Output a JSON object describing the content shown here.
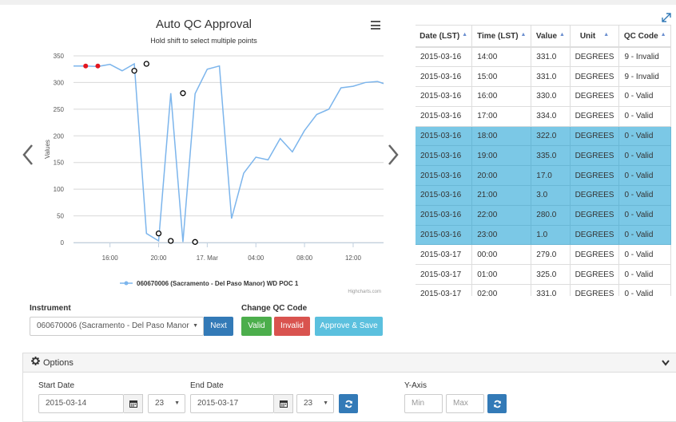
{
  "chart": {
    "title": "Auto QC Approval",
    "subtitle": "Hold shift to select multiple points",
    "ylabel": "Values",
    "legend": "060670006 (Sacramento - Del Paso Manor) WD POC 1",
    "credit": "Highcharts.com"
  },
  "chart_data": {
    "type": "line",
    "title": "Auto QC Approval",
    "ylabel": "Values",
    "ylim": [
      0,
      350
    ],
    "yticks": [
      0,
      50,
      100,
      150,
      200,
      250,
      300,
      350
    ],
    "x_tick_labels": [
      "16:00",
      "20:00",
      "17. Mar",
      "04:00",
      "08:00",
      "12:00"
    ],
    "x_tick_hours": [
      16,
      20,
      24,
      28,
      32,
      36
    ],
    "x_unit": "hours from 2015-03-16 00:00",
    "xlim": [
      13,
      38.5
    ],
    "series": [
      {
        "name": "060670006 (Sacramento - Del Paso Manor) WD POC 1",
        "color": "#7cb5ec",
        "x": [
          13,
          14,
          15,
          16,
          17,
          18,
          19,
          20,
          21,
          22,
          23,
          24,
          25,
          26,
          27,
          28,
          29,
          30,
          31,
          32,
          33,
          34,
          35,
          36,
          37,
          38,
          38.5
        ],
        "values": [
          331,
          331,
          330,
          334,
          322,
          335,
          17,
          3,
          280,
          1,
          279,
          325,
          331,
          45,
          130,
          160,
          155,
          195,
          170,
          210,
          240,
          250,
          290,
          293,
          300,
          302,
          298
        ]
      }
    ],
    "invalid_points": [
      [
        14,
        331
      ],
      [
        15,
        331
      ]
    ],
    "selected_points": [
      [
        18,
        322
      ],
      [
        19,
        335
      ],
      [
        20,
        17
      ],
      [
        21,
        3
      ],
      [
        22,
        280
      ],
      [
        23,
        1
      ]
    ],
    "invalid_color": "#e3161f"
  },
  "table": {
    "headers": [
      "Date (LST)",
      "Time (LST)",
      "Value",
      "Unit",
      "QC Code"
    ],
    "rows": [
      {
        "date": "2015-03-16",
        "time": "14:00",
        "value": "331.0",
        "unit": "DEGREES",
        "qc": "9 - Invalid",
        "selected": false
      },
      {
        "date": "2015-03-16",
        "time": "15:00",
        "value": "331.0",
        "unit": "DEGREES",
        "qc": "9 - Invalid",
        "selected": false
      },
      {
        "date": "2015-03-16",
        "time": "16:00",
        "value": "330.0",
        "unit": "DEGREES",
        "qc": "0 - Valid",
        "selected": false
      },
      {
        "date": "2015-03-16",
        "time": "17:00",
        "value": "334.0",
        "unit": "DEGREES",
        "qc": "0 - Valid",
        "selected": false
      },
      {
        "date": "2015-03-16",
        "time": "18:00",
        "value": "322.0",
        "unit": "DEGREES",
        "qc": "0 - Valid",
        "selected": true
      },
      {
        "date": "2015-03-16",
        "time": "19:00",
        "value": "335.0",
        "unit": "DEGREES",
        "qc": "0 - Valid",
        "selected": true
      },
      {
        "date": "2015-03-16",
        "time": "20:00",
        "value": "17.0",
        "unit": "DEGREES",
        "qc": "0 - Valid",
        "selected": true
      },
      {
        "date": "2015-03-16",
        "time": "21:00",
        "value": "3.0",
        "unit": "DEGREES",
        "qc": "0 - Valid",
        "selected": true
      },
      {
        "date": "2015-03-16",
        "time": "22:00",
        "value": "280.0",
        "unit": "DEGREES",
        "qc": "0 - Valid",
        "selected": true
      },
      {
        "date": "2015-03-16",
        "time": "23:00",
        "value": "1.0",
        "unit": "DEGREES",
        "qc": "0 - Valid",
        "selected": true
      },
      {
        "date": "2015-03-17",
        "time": "00:00",
        "value": "279.0",
        "unit": "DEGREES",
        "qc": "0 - Valid",
        "selected": false
      },
      {
        "date": "2015-03-17",
        "time": "01:00",
        "value": "325.0",
        "unit": "DEGREES",
        "qc": "0 - Valid",
        "selected": false
      },
      {
        "date": "2015-03-17",
        "time": "02:00",
        "value": "331.0",
        "unit": "DEGREES",
        "qc": "0 - Valid",
        "selected": false
      }
    ]
  },
  "controls": {
    "instrument_label": "Instrument",
    "instrument_value": "060670006 (Sacramento - Del Paso Manor",
    "next_label": "Next",
    "change_qc_label": "Change QC Code",
    "valid_label": "Valid",
    "invalid_label": "Invalid",
    "approve_label": "Approve & Save"
  },
  "options": {
    "title": "Options",
    "start_date_label": "Start Date",
    "start_date": "2015-03-14",
    "start_hour": "23",
    "end_date_label": "End Date",
    "end_date": "2015-03-17",
    "end_hour": "23",
    "yaxis_label": "Y-Axis",
    "min_placeholder": "Min",
    "max_placeholder": "Max"
  },
  "colors": {
    "primary": "#337ab7",
    "success": "#4cae4c",
    "danger": "#d9534f",
    "info": "#5bc0de",
    "selected_row": "#7bc8e6",
    "series": "#7cb5ec"
  },
  "icons": [
    "menu-icon",
    "chevron-left-icon",
    "chevron-right-icon",
    "expand-icon",
    "sort-up-icon",
    "caret-down-icon",
    "gear-icon",
    "chevron-down-icon",
    "calendar-icon",
    "refresh-icon"
  ]
}
